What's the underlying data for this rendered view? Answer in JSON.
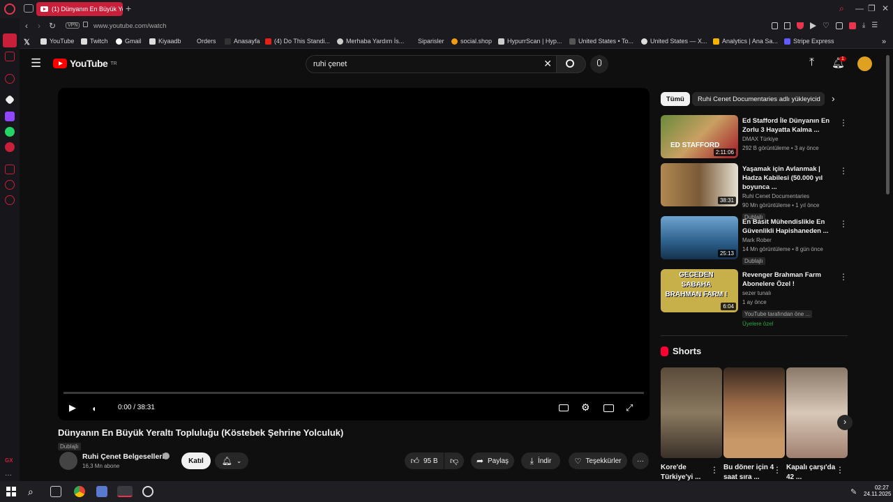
{
  "browser": {
    "tab_title": "(1) Dünyanın En Büyük Yer",
    "url": "www.youtube.com/watch",
    "vpn_label": "VPN",
    "bookmarks": [
      "YouTube",
      "Twitch",
      "Gmail",
      "Kiyaadb",
      "Orders",
      "Anasayfa",
      "(4) Do This Standi...",
      "Merhaba Yardım İs...",
      "Siparisler",
      "social.shop",
      "HypurrScan | Hyp...",
      "United States • To...",
      "United States — X...",
      "Analytics | Ana Sa...",
      "Stripe Express"
    ],
    "accent_color": "#c8203b"
  },
  "youtube": {
    "logo_text": "YouTube",
    "logo_superscript": "TR",
    "search_value": "ruhi çenet",
    "notification_count": "1",
    "player": {
      "time_display": "0:00 / 38:31"
    },
    "video": {
      "title": "Dünyanın En Büyük Yeraltı Topluluğu (Köstebek Şehrine Yolculuk)",
      "dub_badge": "Dublajlı",
      "channel_name": "Ruhi Çenet Belgeselleri",
      "subscribers": "16,3 Mn abone",
      "join_label": "Katıl",
      "like_count": "95 B",
      "share_label": "Paylaş",
      "download_label": "İndir",
      "thanks_label": "Teşekkürler"
    },
    "chips": [
      "Tümü",
      "Ruhi Cenet Documentaries adlı yükleyicid"
    ],
    "recommendations": [
      {
        "title": "Ed Stafford İle Dünyanın En Zorlu 3 Hayatta Kalma ...",
        "channel": "DMAX Türkiye",
        "meta": "292 B görüntüleme • 3 ay önce",
        "duration": "2:11:06",
        "thumb_text": "ED STAFFORD",
        "badge": ""
      },
      {
        "title": "Yaşamak için Avlanmak | Hadza Kabilesi (50.000 yıl boyunca ...",
        "channel": "Ruhi Cenet Documentaries",
        "meta": "90 Mn görüntüleme • 1 yıl önce",
        "duration": "38:31",
        "thumb_text": "",
        "badge": "Dublajlı"
      },
      {
        "title": "En Basit Mühendislikle En Güvenlikli Hapishaneden ...",
        "channel": "Mark Rober",
        "meta": "14 Mn görüntüleme • 8 gün önce",
        "duration": "25:13",
        "thumb_text": "",
        "badge": "Dublajlı"
      },
      {
        "title": "Revenger Brahman Farm Abonelere Özel !",
        "channel": "sezer tunalı",
        "meta": "1 ay önce",
        "duration": "6:04",
        "thumb_text": "GECEDEN SABAHA BRAHMAN FARM !",
        "badge": "YouTube tarafından öne ...",
        "extra": "Üyelere özel"
      }
    ],
    "shorts_title": "Shorts",
    "shorts": [
      {
        "caption": "Kore'de Türkiye'yi ..."
      },
      {
        "caption": "Bu döner için 4 saat sıra ..."
      },
      {
        "caption": "Kapalı çarşı'da 42 ..."
      }
    ]
  },
  "taskbar": {
    "time": "02:27",
    "date": "24.11.2025"
  }
}
